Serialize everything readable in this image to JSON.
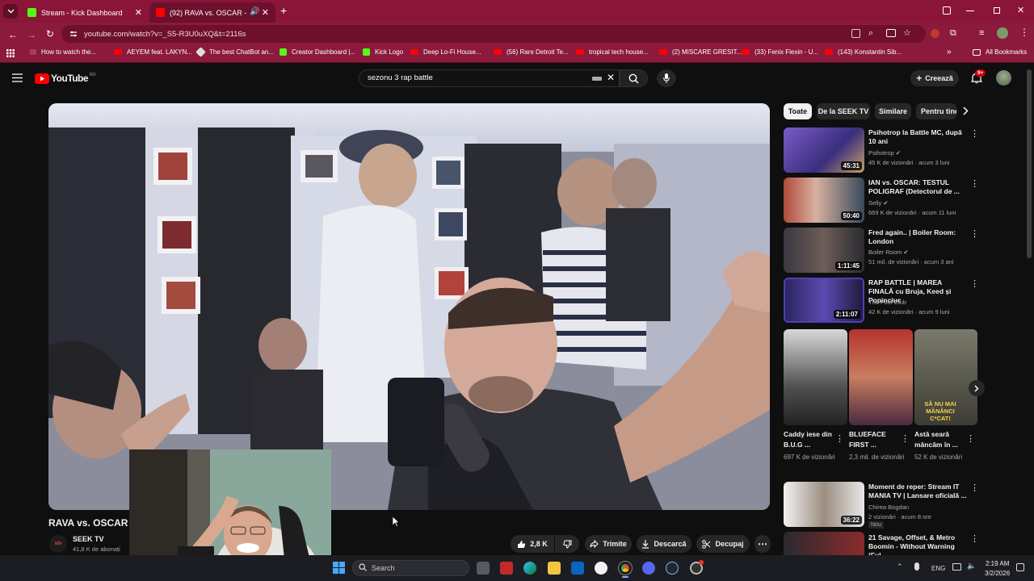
{
  "browser": {
    "tabs": [
      {
        "label": "Stream - Kick Dashboard"
      },
      {
        "label": "(92) RAVA vs. OSCAR - Rap"
      }
    ],
    "new_tab": "+",
    "url": "youtube.com/watch?v=_S5-R3U0uXQ&t=2116s",
    "bookmarks": [
      "How to watch the...",
      "AEYEM feat. LAKYN...",
      "The best ChatBot an...",
      "Creator Dashboard |...",
      "Kick Logo",
      "Deep Lo-Fi House...",
      "(56) Rare Detroit Te...",
      "tropical tech house...",
      "(2) MISCARE GRESIT...",
      "(33) Fenix Flexin - U...",
      "(143) Konstantin Sib..."
    ],
    "all_bookmarks": "All Bookmarks",
    "accent": "#8c1a3d"
  },
  "youtube": {
    "logo": "YouTube",
    "logo_region": "RO",
    "search_value": "sezonu 3 rap battle",
    "create_label": "Creează",
    "notif_count": "9+"
  },
  "video": {
    "title": "RAVA vs. OSCAR -",
    "channel": "SEEK TV",
    "channel_avatar": "stv",
    "subscribers": "41,8 K de abonați",
    "likes": "2,8 K",
    "share": "Trimite",
    "download": "Descarcă",
    "clip": "Decupaj"
  },
  "chips": [
    "Toate",
    "De la SEEK TV",
    "Similare",
    "Pentru tine"
  ],
  "recommendations": [
    {
      "title": "Psihotrop la Battle MC, după 10 ani",
      "channel": "Psihotrop",
      "verified": true,
      "meta": "45 K de vizionări · acum 3 luni",
      "duration": "45:31",
      "thumb_color": "#5c4d9e"
    },
    {
      "title": "IAN vs. OSCAR: TESTUL POLIGRAF (Detectorul de ...",
      "channel": "Selly",
      "verified": true,
      "meta": "669 K de vizionări · acum 11 luni",
      "duration": "50:40",
      "thumb_color": "#a34a3c"
    },
    {
      "title": "Fred again.. | Boiler Room: London",
      "channel": "Boiler Room",
      "verified": true,
      "meta": "51 mil. de vizionări · acum 3 ani",
      "duration": "1:11:45",
      "thumb_color": "#3d3a45"
    },
    {
      "title": "RAP BATTLE | MAREA FINALĂ cu Bruja, Keed și Popinciuc",
      "channel": "The Fool Club",
      "verified": false,
      "meta": "42 K de vizionări · acum 9 luni",
      "duration": "2:11:07",
      "thumb_color": "#3c2f6e"
    }
  ],
  "shorts": [
    {
      "title": "Caddy iese din B.U.G ...",
      "views": "697 K de vizionări"
    },
    {
      "title": "BLUEFACE FIRST ...",
      "views": "2,3 mil. de vizionări"
    },
    {
      "title": "Astă seară mâncăm în ...",
      "views": "52 K de vizionări"
    }
  ],
  "short_overlay_text": "SĂ NU MAI MÂNÂNCI C*CAT!",
  "rec_after": [
    {
      "title": "Moment de reper: Stream IT MANIA TV | Lansare oficială ...",
      "channel": "Chirea Bogdan",
      "meta": "2 vizionări · acum 8 ore",
      "badge": "Nou",
      "duration": "36:22"
    },
    {
      "title": "21 Savage, Offset, & Metro Boomin - Without Warning (Ful...",
      "channel": "",
      "meta": "",
      "duration": ""
    }
  ],
  "taskbar": {
    "search_placeholder": "Search",
    "language": "ENG",
    "time": "2:19 AM",
    "date": "3/2/2026"
  }
}
